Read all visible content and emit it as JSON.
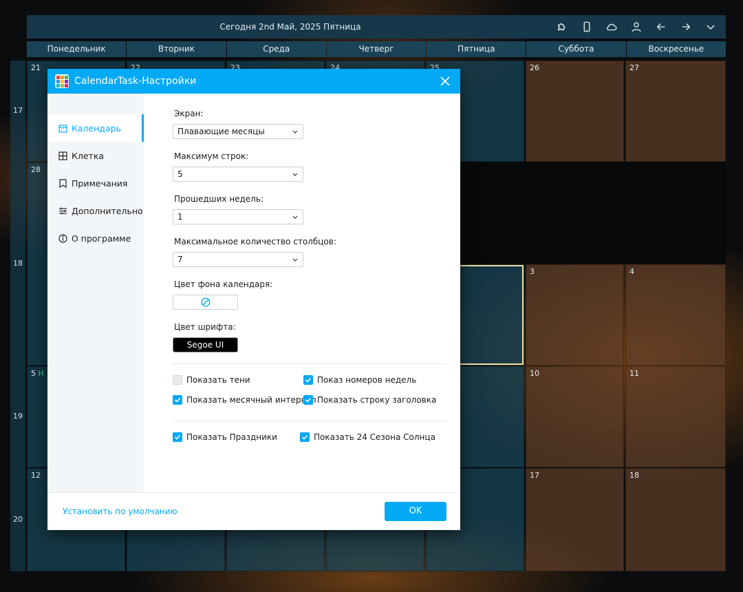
{
  "header": {
    "title": "Сегодня 2nd Май, 2025 Пятница",
    "icons": [
      "puzzle-icon",
      "phone-icon",
      "cloud-icon",
      "user-icon",
      "arrow-left-icon",
      "arrow-right-icon",
      "chevron-down-icon"
    ]
  },
  "weekdays": [
    "Понедельник",
    "Вторник",
    "Среда",
    "Четверг",
    "Пятница",
    "Суббота",
    "Воскресенье"
  ],
  "week_numbers": [
    "17",
    "18",
    "19",
    "20"
  ],
  "visible_days": {
    "r1": [
      "21",
      "22",
      "23",
      "24",
      "25",
      "26",
      "27"
    ],
    "r2": [
      "28",
      "3",
      "4"
    ],
    "r3": [
      "5",
      "Н",
      "10",
      "11"
    ],
    "r4": [
      "12",
      "17",
      "18"
    ]
  },
  "dialog": {
    "title": "CalendarTask-Настройки",
    "nav": [
      {
        "label": "Календарь",
        "icon": "calendar-icon",
        "active": true
      },
      {
        "label": "Клетка",
        "icon": "grid-icon"
      },
      {
        "label": "Примечания",
        "icon": "bookmark-icon"
      },
      {
        "label": "Дополнительно",
        "icon": "sliders-icon"
      },
      {
        "label": "О программе",
        "icon": "info-icon"
      }
    ],
    "fields": {
      "screen": {
        "label": "Экран:",
        "value": "Плавающие месяцы"
      },
      "max_rows": {
        "label": "Максимум строк:",
        "value": "5"
      },
      "past_weeks": {
        "label": "Прошедших недель:",
        "value": "1"
      },
      "max_cols": {
        "label": "Максимальное количество столбцов:",
        "value": "7"
      },
      "bg_color": {
        "label": "Цвет фона календаря:"
      },
      "font_color": {
        "label": "Цвет шрифта:",
        "value": "Segoe UI"
      }
    },
    "checks": {
      "shadows": {
        "label": "Показать тени",
        "checked": false
      },
      "week_numbers": {
        "label": "Показ номеров недель",
        "checked": true
      },
      "month_interval": {
        "label": "Показать месячный интервал",
        "checked": true
      },
      "title_bar": {
        "label": "Показать строку заголовка",
        "checked": true
      },
      "holidays": {
        "label": "Показать Праздники",
        "checked": true
      },
      "solar_terms": {
        "label": "Показать 24 Сезона Солнца",
        "checked": true
      }
    },
    "footer": {
      "reset": "Установить по умолчанию",
      "ok": "OK"
    }
  },
  "colors": {
    "accent": "#03a9f4",
    "header_bg": "#16384a",
    "weekday_cell": "#19465a",
    "weekend_cell": "#5f3e28"
  }
}
